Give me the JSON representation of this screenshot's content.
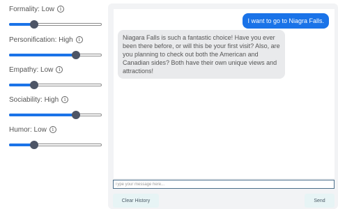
{
  "settings": [
    {
      "label": "Formality: Low",
      "level": 0.27
    },
    {
      "label": "Personification: High",
      "level": 0.72
    },
    {
      "label": "Empathy: Low",
      "level": 0.27
    },
    {
      "label": "Sociability: High",
      "level": 0.72
    },
    {
      "label": "Humor: Low",
      "level": 0.27
    }
  ],
  "icons": {
    "info": "info-icon"
  },
  "colors": {
    "accent": "#1a73e8",
    "user_bubble": "#1a73e8",
    "bot_bubble": "#e9eaec",
    "button_bg": "#e7f4f5"
  },
  "chat": {
    "messages": [
      {
        "role": "user",
        "text": "I want to go to Niagra Falls."
      },
      {
        "role": "assistant",
        "text": "Niagara Falls is such a fantastic choice! Have you ever been there before, or will this be your first visit? Also, are you planning to check out both the American and Canadian sides? Both have their own unique views and attractions!"
      }
    ],
    "input_placeholder": "Type your message here...",
    "input_value": ""
  },
  "buttons": {
    "clear_label": "Clear History",
    "send_label": "Send"
  }
}
